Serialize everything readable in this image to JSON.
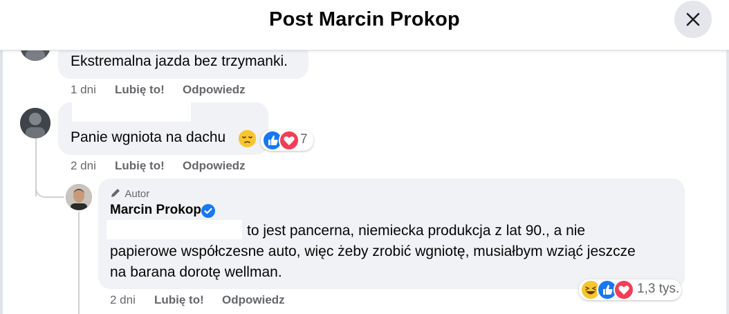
{
  "header": {
    "title": "Post Marcin Prokop"
  },
  "comments": [
    {
      "text": "Ekstremalna jazda bez trzymanki.",
      "time": "1 dni",
      "like_label": "Lubię to!",
      "reply_label": "Odpowiedz"
    },
    {
      "text": "Panie wgniota na dachu",
      "time": "2 dni",
      "like_label": "Lubię to!",
      "reply_label": "Odpowiedz",
      "reactions": {
        "count": "7",
        "icons": [
          "like-icon",
          "love-icon"
        ]
      }
    }
  ],
  "reply": {
    "badge": "Autor",
    "author": "Marcin Prokop",
    "lines": [
      "to jest pancerna, niemiecka produkcja z lat 90., a nie",
      "papierowe współczesne auto, więc żeby zrobić wgniotę, musiałbym wziąć jeszcze",
      "na barana dorotę wellman."
    ],
    "time": "2 dni",
    "like_label": "Lubię to!",
    "reply_label": "Odpowiedz",
    "reactions": {
      "count": "1,3 tys.",
      "icons": [
        "haha-icon",
        "like-icon",
        "love-icon"
      ]
    }
  },
  "colors": {
    "accent": "#1877f2",
    "love": "#f33e58",
    "muted": "#65676b",
    "bubble": "#f0f2f5"
  }
}
